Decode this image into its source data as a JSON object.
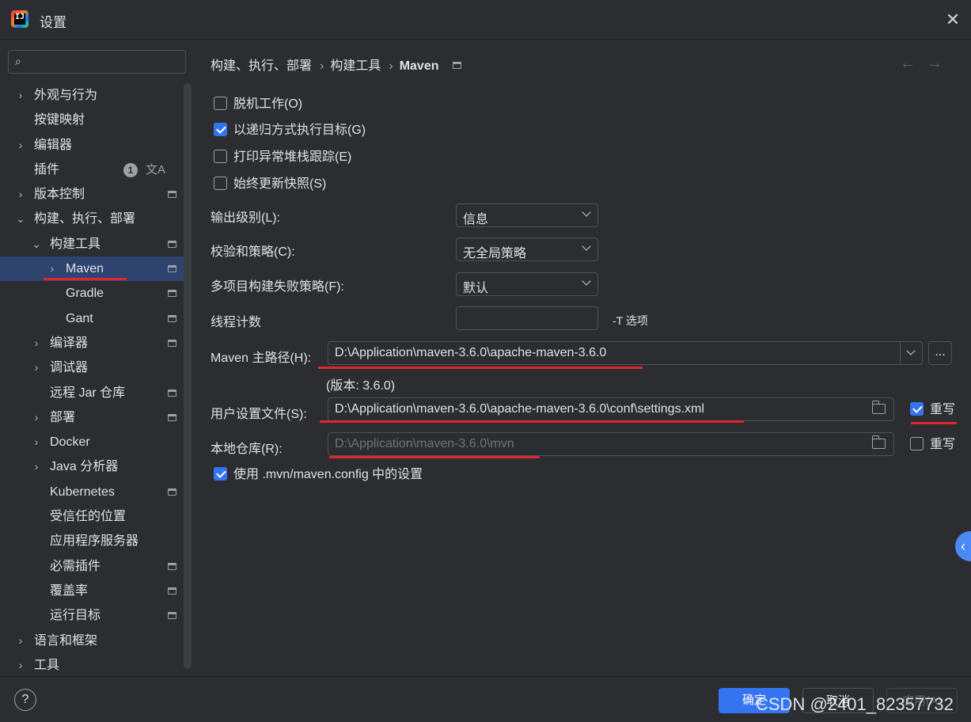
{
  "window": {
    "title": "设置",
    "logo_text": "IJ"
  },
  "search": {
    "placeholder": ""
  },
  "sidebar": {
    "items": [
      {
        "label": "外观与行为",
        "arrow": "›",
        "pinned": false
      },
      {
        "label": "按键映射",
        "arrow": "",
        "pinned": false
      },
      {
        "label": "编辑器",
        "arrow": "›",
        "pinned": false
      },
      {
        "label": "插件",
        "arrow": "",
        "pinned": false,
        "badge": "1",
        "translate_icon": "文A"
      },
      {
        "label": "版本控制",
        "arrow": "›",
        "pinned": true
      },
      {
        "label": "构建、执行、部署",
        "arrow": "⌄",
        "pinned": false
      },
      {
        "label": "构建工具",
        "arrow": "⌄",
        "pinned": true
      },
      {
        "label": "Maven",
        "arrow": "›",
        "pinned": true,
        "selected": true
      },
      {
        "label": "Gradle",
        "arrow": "",
        "pinned": true
      },
      {
        "label": "Gant",
        "arrow": "",
        "pinned": true
      },
      {
        "label": "编译器",
        "arrow": "›",
        "pinned": true
      },
      {
        "label": "调试器",
        "arrow": "›",
        "pinned": false
      },
      {
        "label": "远程 Jar 仓库",
        "arrow": "",
        "pinned": true
      },
      {
        "label": "部署",
        "arrow": "›",
        "pinned": true
      },
      {
        "label": "Docker",
        "arrow": "›",
        "pinned": false
      },
      {
        "label": "Java 分析器",
        "arrow": "›",
        "pinned": false
      },
      {
        "label": "Kubernetes",
        "arrow": "",
        "pinned": true
      },
      {
        "label": "受信任的位置",
        "arrow": "",
        "pinned": false
      },
      {
        "label": "应用程序服务器",
        "arrow": "",
        "pinned": false
      },
      {
        "label": "必需插件",
        "arrow": "",
        "pinned": true
      },
      {
        "label": "覆盖率",
        "arrow": "",
        "pinned": true
      },
      {
        "label": "运行目标",
        "arrow": "",
        "pinned": true
      },
      {
        "label": "语言和框架",
        "arrow": "›",
        "pinned": false
      },
      {
        "label": "工具",
        "arrow": "›",
        "pinned": false
      }
    ]
  },
  "breadcrumb": {
    "part1": "构建、执行、部署",
    "part2": "构建工具",
    "current": "Maven",
    "sep": "›"
  },
  "nav": {
    "back": "←",
    "forward": "→"
  },
  "options": {
    "offline": {
      "label": "脱机工作(O)",
      "checked": false
    },
    "recursive": {
      "label": "以递归方式执行目标(G)",
      "checked": true
    },
    "print_stack": {
      "label": "打印异常堆栈跟踪(E)",
      "checked": false
    },
    "always_update": {
      "label": "始终更新快照(S)",
      "checked": false
    },
    "use_mvn_config": {
      "label": "使用 .mvn/maven.config 中的设置",
      "checked": true
    }
  },
  "fields": {
    "output_level": {
      "label": "输出级别(L):",
      "value": "信息"
    },
    "checksum_policy": {
      "label": "校验和策略(C):",
      "value": "无全局策略"
    },
    "multiproject_fail": {
      "label": "多项目构建失败策略(F):",
      "value": "默认"
    },
    "thread_count": {
      "label": "线程计数",
      "value": "",
      "suffix": "-T 选项"
    },
    "maven_home": {
      "label": "Maven 主路径(H):",
      "value": "D:\\Application\\maven-3.6.0\\apache-maven-3.6.0",
      "version": "(版本: 3.6.0)",
      "more": "..."
    },
    "user_settings": {
      "label": "用户设置文件(S):",
      "value": "D:\\Application\\maven-3.6.0\\apache-maven-3.6.0\\conf\\settings.xml",
      "override_label": "重写",
      "override_checked": true
    },
    "local_repo": {
      "label": "本地仓库(R):",
      "value": "D:\\Application\\maven-3.6.0\\mvn",
      "override_label": "重写",
      "override_checked": false
    }
  },
  "footer": {
    "help": "?",
    "ok": "确定",
    "cancel": "取消",
    "apply": "应用(A)",
    "watermark": "CSDN @2401_82357732"
  },
  "colors": {
    "accent": "#3574f0",
    "selection": "#2e436e",
    "annotation_red": "#e0262f",
    "background": "#2b2d30"
  }
}
